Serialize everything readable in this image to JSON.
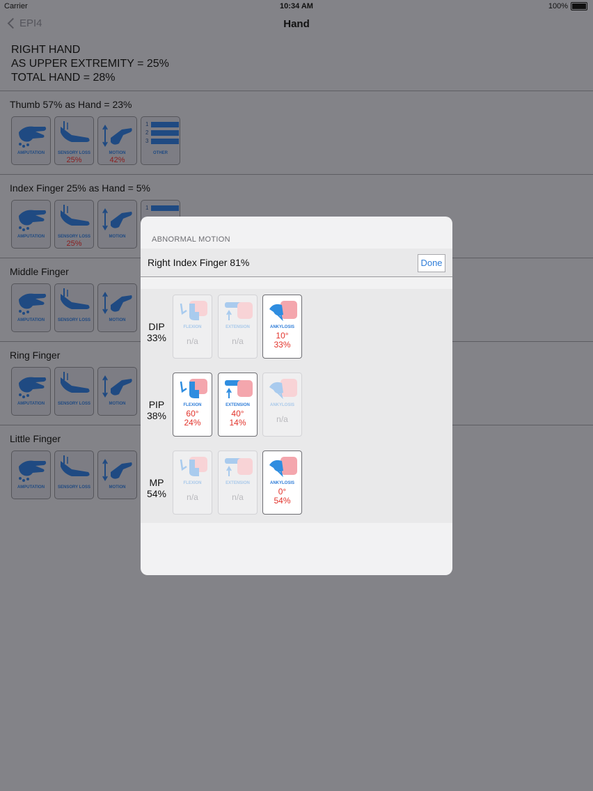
{
  "status": {
    "carrier": "Carrier",
    "time": "10:34 AM",
    "battery": "100%"
  },
  "nav": {
    "back_label": "EPI4",
    "title": "Hand"
  },
  "summary": {
    "line1": "RIGHT HAND",
    "line2": "AS UPPER EXTREMITY = 25%",
    "line3": "TOTAL HAND = 28%"
  },
  "sections": [
    {
      "title": "Thumb  57%  as Hand = 23%",
      "tiles": [
        {
          "label": "AMPUTATION",
          "value": ""
        },
        {
          "label": "SENSORY LOSS",
          "value": "25%"
        },
        {
          "label": "MOTION",
          "value": "42%"
        },
        {
          "label": "OTHER",
          "value": ""
        }
      ],
      "other_numbers": [
        "1",
        "2",
        "3"
      ]
    },
    {
      "title": "Index Finger  25%  as Hand = 5%",
      "tiles": [
        {
          "label": "AMPUTATION",
          "value": ""
        },
        {
          "label": "SENSORY LOSS",
          "value": "25%"
        },
        {
          "label": "MOTION",
          "value": ""
        }
      ],
      "other_numbers": [
        "1"
      ]
    },
    {
      "title": "Middle Finger",
      "tiles": [
        {
          "label": "AMPUTATION",
          "value": ""
        },
        {
          "label": "SENSORY LOSS",
          "value": ""
        },
        {
          "label": "MOTION",
          "value": ""
        }
      ]
    },
    {
      "title": "Ring Finger",
      "tiles": [
        {
          "label": "AMPUTATION",
          "value": ""
        },
        {
          "label": "SENSORY LOSS",
          "value": ""
        },
        {
          "label": "MOTION",
          "value": ""
        }
      ]
    },
    {
      "title": "Little Finger",
      "tiles": [
        {
          "label": "AMPUTATION",
          "value": ""
        },
        {
          "label": "SENSORY LOSS",
          "value": ""
        },
        {
          "label": "MOTION",
          "value": ""
        }
      ]
    }
  ],
  "modal": {
    "header": "ABNORMAL MOTION",
    "row_text": "Right  Index Finger  81%",
    "done_label": "Done",
    "joints": [
      {
        "name": "DIP",
        "pct": "33%",
        "cells": [
          {
            "label": "FLEXION",
            "active": false,
            "na": "n/a"
          },
          {
            "label": "EXTENSION",
            "active": false,
            "na": "n/a"
          },
          {
            "label": "ANKYLOSIS",
            "active": true,
            "deg": "10°",
            "pct": "33%"
          }
        ]
      },
      {
        "name": "PIP",
        "pct": "38%",
        "cells": [
          {
            "label": "FLEXION",
            "active": true,
            "deg": "60°",
            "pct": "24%"
          },
          {
            "label": "EXTENSION",
            "active": true,
            "deg": "40°",
            "pct": "14%"
          },
          {
            "label": "ANKYLOSIS",
            "active": false,
            "na": "n/a"
          }
        ]
      },
      {
        "name": "MP",
        "pct": "54%",
        "cells": [
          {
            "label": "FLEXION",
            "active": false,
            "na": "n/a"
          },
          {
            "label": "EXTENSION",
            "active": false,
            "na": "n/a"
          },
          {
            "label": "ANKYLOSIS",
            "active": true,
            "deg": "0°",
            "pct": "54%"
          }
        ]
      }
    ]
  },
  "colors": {
    "accent": "#2f7dd8",
    "value_red": "#e2342c",
    "icon_blue": "#1f4a82",
    "dim_bg": "#838388"
  }
}
